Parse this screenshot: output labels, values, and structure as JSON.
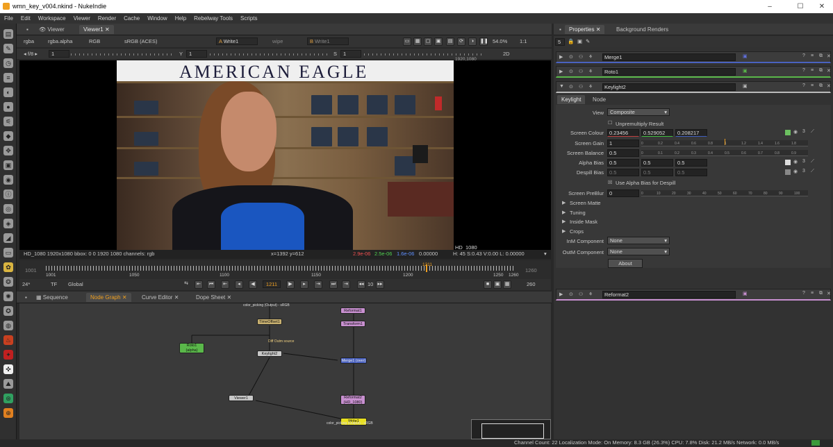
{
  "window": {
    "title": "wmn_key_v004.nkind - NukeIndie",
    "controls": [
      "–",
      "☐",
      "✕"
    ]
  },
  "menu": [
    "File",
    "Edit",
    "Workspace",
    "Viewer",
    "Render",
    "Cache",
    "Window",
    "Help",
    "Rebelway Tools",
    "Scripts"
  ],
  "viewer_tabs": {
    "tab1": "Viewer",
    "tab2": "Viewer1"
  },
  "viewer_controls": {
    "channels": "rgba",
    "alpha": "rgba.alpha",
    "display": "RGB",
    "colorspace": "sRGB (ACES)",
    "a_input": "Write1",
    "wipe": "wipe",
    "b_input": "Write1",
    "zoom": "54.0%",
    "ratio": "1:1",
    "fstop": "f/8",
    "gain_val": "1",
    "gamma_label": "Y",
    "gamma_val": "1",
    "sat_label": "S",
    "sat_val": "1",
    "view_mode": "2D"
  },
  "image": {
    "sign": "AMERICAN EAGLE",
    "format_top_right": "1920,1080",
    "format_bottom": "HD_1080"
  },
  "viewer_status": {
    "left": "HD_1080 1920x1080  bbox: 0 0 1920 1080 channels: rgb",
    "coords": "x=1392 y=612",
    "r": "2.9e-06",
    "g": "2.5e-06",
    "b": "1.6e-06",
    "a": "0.00000",
    "hsv": "H: 45 S:0.43 V:0.00  L: 0.00000"
  },
  "timeline": {
    "start": "1001",
    "end": "1260",
    "current_marker": "1211",
    "ticks": [
      "1001",
      "1050",
      "1100",
      "1150",
      "1200",
      "1250",
      "1260"
    ]
  },
  "playback": {
    "fps": "24*",
    "tf": "TF",
    "scope": "Global",
    "frame": "1211",
    "step": "10",
    "end_frame": "260"
  },
  "graph_tabs": {
    "sequence": "Sequence",
    "node_graph": "Node Graph",
    "curve_editor": "Curve Editor",
    "dope_sheet": "Dope Sheet"
  },
  "nodes": {
    "timeoffset": "TimeOffset1",
    "roto": "Roto1",
    "roto_sub": "(alpha)",
    "keylight": "Keylight2",
    "viewer": "Viewer1",
    "reformat1": "Reformat1",
    "transform": "Transform1",
    "merge": "Merge1 (over)",
    "reformat2": "Reformat2",
    "reformat2_sub": "(HD_1080)",
    "write": "Write1",
    "write_sub": "color_picking (Output) - sRGB",
    "top_read_sub": "color_picking (Output) - sRGB",
    "dot_label": "Diff Outm source"
  },
  "properties": {
    "tab1": "Properties",
    "tab2": "Background Renders",
    "count": "5",
    "node_merge": "Merge1",
    "node_roto": "Roto1",
    "node_keylight": "Keylight2",
    "node_reformat": "Reformat2",
    "subtab1": "Keylight",
    "subtab2": "Node",
    "view_label": "View",
    "view_value": "Composite",
    "unpremult": "Unpremultiply Result",
    "screen_colour_label": "Screen Colour",
    "screen_colour": [
      "0.23456",
      "0.529052",
      "0.208217"
    ],
    "screen_gain_label": "Screen Gain",
    "screen_gain": "1",
    "screen_balance_label": "Screen Balance",
    "screen_balance": "0.5",
    "alpha_bias_label": "Alpha Bias",
    "alpha_bias": [
      "0.5",
      "0.5",
      "0.5"
    ],
    "despill_bias_label": "Despill Bias",
    "despill_bias": [
      "0.5",
      "0.5",
      "0.5"
    ],
    "use_alpha_bias": "Use Alpha Bias for Despill",
    "preblur_label": "Screen PreBlur",
    "preblur": "0",
    "sections": [
      "Screen Matte",
      "Tuning",
      "Inside Mask",
      "Crops"
    ],
    "inm_label": "InM Component",
    "inm_value": "None",
    "outm_label": "OutM Component",
    "outm_value": "None",
    "about": "About",
    "gain_ticks": [
      "0",
      "0.2",
      "0.4",
      "0.6",
      "0.8",
      "1",
      "1.2",
      "1.4",
      "1.6",
      "1.8"
    ],
    "balance_ticks": [
      "0",
      "0.1",
      "0.2",
      "0.3",
      "0.4",
      "0.5",
      "0.6",
      "0.7",
      "0.8",
      "0.9"
    ],
    "preblur_ticks": [
      "0",
      "10",
      "20",
      "30",
      "40",
      "50",
      "60",
      "70",
      "80",
      "90",
      "100"
    ]
  },
  "status_bar": "Channel Count: 22  Localization Mode: On  Memory: 8.3 GB (26.3%)  CPU: 7.8%  Disk: 21.2 MB/s  Network: 0.0 MB/s"
}
